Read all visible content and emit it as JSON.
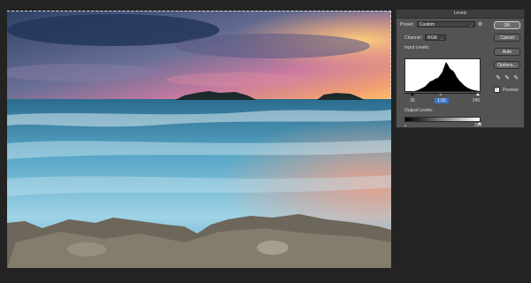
{
  "dialog": {
    "title": "Levels",
    "preset_label": "Preset:",
    "preset_value": "Custom",
    "channel_label": "Channel:",
    "channel_value": "RGB",
    "input_levels_label": "Input Levels:",
    "input_black": "26",
    "input_gamma": "1.02",
    "input_white": "245",
    "output_levels_label": "Output Levels:",
    "output_black": "0",
    "output_white": "255",
    "ok_label": "OK",
    "cancel_label": "Cancel",
    "auto_label": "Auto",
    "options_label": "Options...",
    "preview_label": "Preview",
    "preview_checked": true
  },
  "icons": {
    "gear": "gear-icon",
    "eyedropper_black": "eyedropper-black-icon",
    "eyedropper_gray": "eyedropper-gray-icon",
    "eyedropper_white": "eyedropper-white-icon"
  },
  "colors": {
    "panel_bg": "#535353",
    "app_bg": "#232323",
    "selected_field": "#3a74c9"
  }
}
